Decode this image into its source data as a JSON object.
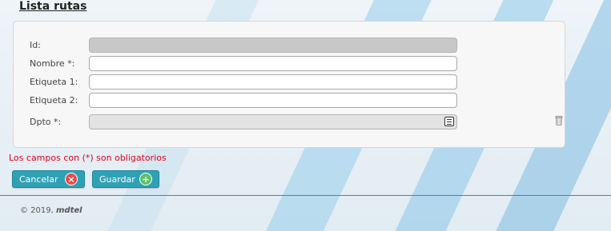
{
  "page": {
    "title": "Lista rutas"
  },
  "form": {
    "fields": [
      {
        "label": "Id:",
        "value": "",
        "state": "disabled"
      },
      {
        "label": "Nombre *:",
        "value": "",
        "state": "editable"
      },
      {
        "label": "Etiqueta 1:",
        "value": "",
        "state": "editable"
      },
      {
        "label": "Etiqueta 2:",
        "value": "",
        "state": "editable"
      },
      {
        "label": "Dpto *:",
        "value": "",
        "state": "readonly",
        "icon": "list-icon",
        "action_icon": "trash-icon"
      }
    ],
    "required_note": "Los campos con (*) son obligatorios"
  },
  "buttons": {
    "cancel": {
      "label": "Cancelar",
      "icon": "close-circle-icon",
      "color": "#2fa1b5"
    },
    "save": {
      "label": "Guardar",
      "icon": "plus-circle-icon",
      "color": "#2fa1b5"
    }
  },
  "footer": {
    "copyright": "© 2019,",
    "brand": "mdtel"
  }
}
